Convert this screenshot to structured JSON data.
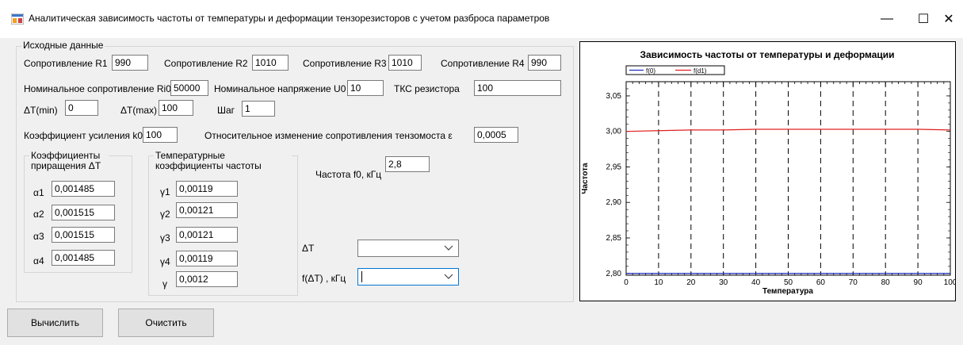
{
  "window": {
    "title": "Аналитическая зависимость частоты от температуры и деформации тензорезисторов с учетом разброса параметров",
    "minimize": "—",
    "maximize": "☐",
    "close": "✕"
  },
  "input_group": {
    "title": "Исходные данные",
    "r1_label": "Сопротивление R1",
    "r1": "990",
    "r2_label": "Сопротивление R2",
    "r2": "1010",
    "r3_label": "Сопротивление R3",
    "r3": "1010",
    "r4_label": "Сопротивление R4",
    "r4": "990",
    "ri0_label": "Номинальное сопротивление Ri0",
    "ri0": "50000",
    "u0_label": "Номинальное напряжение U0",
    "u0": "10",
    "tkc_label": "ТКС резистора",
    "tkc": "100",
    "dtmin_label": "ΔT(min)",
    "dtmin": "0",
    "dtmax_label": "ΔT(max)",
    "dtmax": "100",
    "step_label": "Шаг",
    "step": "1",
    "k0_label": "Коэффициент усиления k0",
    "k0": "100",
    "eps_label": "Относительное изменение сопротивления тензомоста ε",
    "eps": "0,0005",
    "f0_label": "Частота f0, кГц",
    "f0": "2,8"
  },
  "alpha_group": {
    "title": "Коэффициенты приращения ΔT",
    "a1_label": "α1",
    "a1": "0,001485",
    "a2_label": "α2",
    "a2": "0,001515",
    "a3_label": "α3",
    "a3": "0,001515",
    "a4_label": "α4",
    "a4": "0,001485"
  },
  "gamma_group": {
    "title": "Температурные коэффициенты частоты",
    "g1_label": "γ1",
    "g1": "0,00119",
    "g2_label": "γ2",
    "g2": "0,00121",
    "g3_label": "γ3",
    "g3": "0,00121",
    "g4_label": "γ4",
    "g4": "0,00119",
    "g_label": "γ",
    "g": "0,0012"
  },
  "result": {
    "dt_label": "ΔT",
    "dt_value": "",
    "fdt_label": "f(ΔT) , кГц",
    "fdt_value": ""
  },
  "buttons": {
    "calc": "Вычислить",
    "clear": "Очистить"
  },
  "colors": {
    "series_f0": "#1f2fbf",
    "series_fd1": "#e02020"
  },
  "chart_data": {
    "type": "line",
    "title": "Зависимость частоты от температуры и деформации",
    "xlabel": "Температура",
    "ylabel": "Частота",
    "xlim": [
      0,
      100
    ],
    "ylim": [
      2.7975,
      3.07
    ],
    "x_ticks": [
      "0",
      "10",
      "20",
      "30",
      "40",
      "50",
      "60",
      "70",
      "80",
      "90",
      "100"
    ],
    "y_ticks": [
      "2,80",
      "2,85",
      "2,90",
      "2,95",
      "3,00",
      "3,05"
    ],
    "y_tick_values": [
      2.8,
      2.85,
      2.9,
      2.95,
      3.0,
      3.05
    ],
    "grid": "vertical dashed",
    "legend_position": "top-left",
    "series": [
      {
        "name": "f(0)",
        "x": [
          0,
          100
        ],
        "values": [
          2.8,
          2.8
        ]
      },
      {
        "name": "f(d1)",
        "x": [
          0,
          10,
          20,
          30,
          40,
          50,
          60,
          70,
          80,
          90,
          100
        ],
        "values": [
          3.0,
          3.001,
          3.002,
          3.002,
          3.003,
          3.003,
          3.003,
          3.003,
          3.003,
          3.003,
          3.002
        ]
      }
    ]
  }
}
